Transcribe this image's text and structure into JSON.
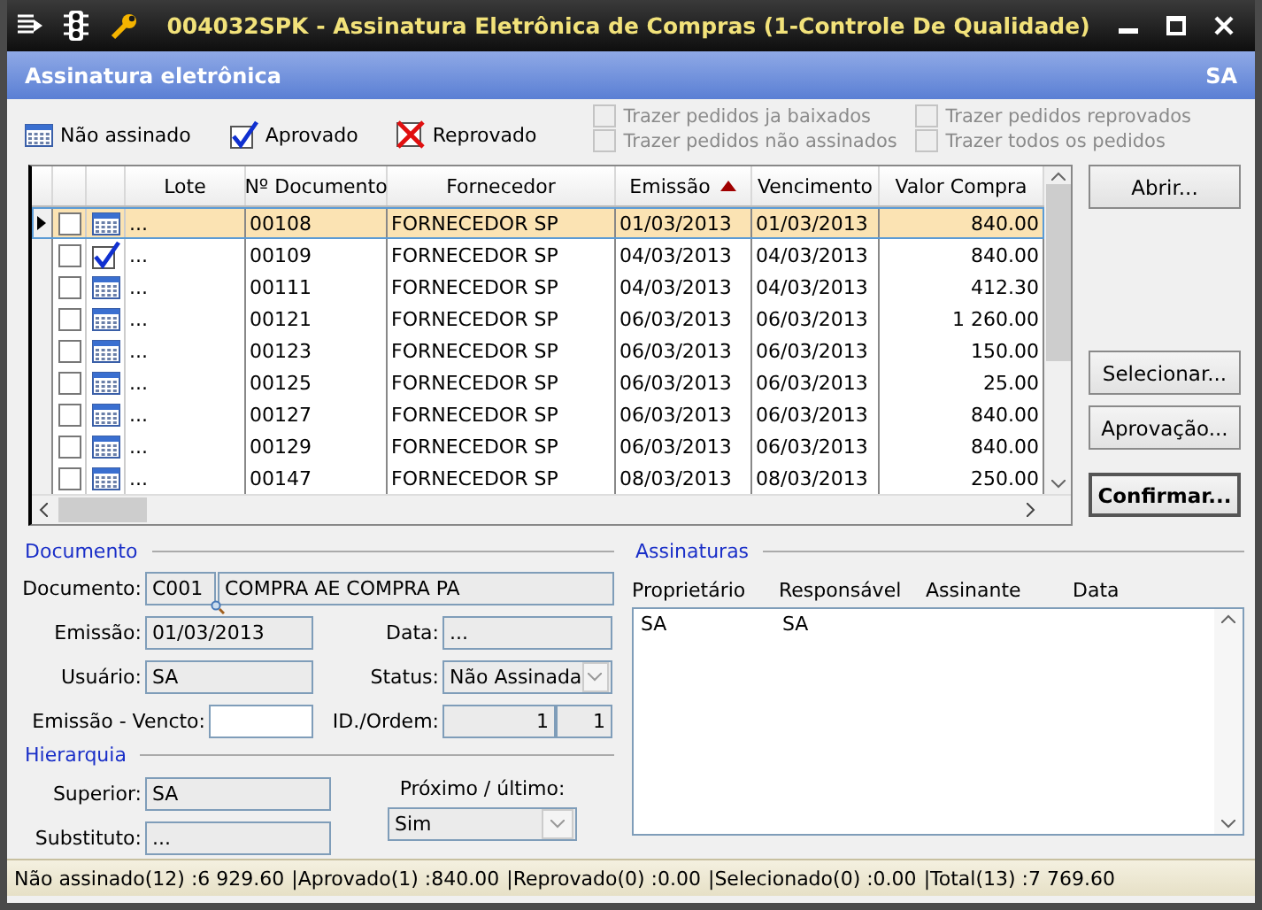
{
  "window": {
    "title": "004032SPK - Assinatura Eletrônica de Compras (1-Controle De Qualidade)"
  },
  "header": {
    "title": "Assinatura eletrônica",
    "user": "SA"
  },
  "legend": [
    {
      "kind": "pending",
      "label": "Não assinado"
    },
    {
      "kind": "approved",
      "label": "Aprovado"
    },
    {
      "kind": "rejected",
      "label": "Reprovado"
    }
  ],
  "filters": [
    {
      "label": "Trazer pedidos ja baixados",
      "checked": false,
      "disabled": true
    },
    {
      "label": "Trazer pedidos não assinados",
      "checked": false,
      "disabled": true
    },
    {
      "label": "Trazer pedidos reprovados",
      "checked": false,
      "disabled": true
    },
    {
      "label": "Trazer todos os pedidos",
      "checked": false,
      "disabled": true
    }
  ],
  "table": {
    "columns": [
      {
        "label": "Lote",
        "sorted": false
      },
      {
        "label": "Nº Documento",
        "sorted": false
      },
      {
        "label": "Fornecedor",
        "sorted": false
      },
      {
        "label": "Emissão",
        "sorted": true
      },
      {
        "label": "Vencimento",
        "sorted": false
      },
      {
        "label": "Valor Compra",
        "sorted": false
      }
    ],
    "rows": [
      {
        "selected": true,
        "checked": false,
        "kind": "pending",
        "cells": [
          "...",
          "00108",
          "FORNECEDOR SP",
          "01/03/2013",
          "01/03/2013",
          "840.00"
        ]
      },
      {
        "selected": false,
        "checked": false,
        "kind": "approved",
        "cells": [
          "...",
          "00109",
          "FORNECEDOR SP",
          "04/03/2013",
          "04/03/2013",
          "840.00"
        ]
      },
      {
        "selected": false,
        "checked": false,
        "kind": "pending",
        "cells": [
          "...",
          "00111",
          "FORNECEDOR SP",
          "04/03/2013",
          "04/03/2013",
          "412.30"
        ]
      },
      {
        "selected": false,
        "checked": false,
        "kind": "pending",
        "cells": [
          "...",
          "00121",
          "FORNECEDOR SP",
          "06/03/2013",
          "06/03/2013",
          "1 260.00"
        ]
      },
      {
        "selected": false,
        "checked": false,
        "kind": "pending",
        "cells": [
          "...",
          "00123",
          "FORNECEDOR SP",
          "06/03/2013",
          "06/03/2013",
          "150.00"
        ]
      },
      {
        "selected": false,
        "checked": false,
        "kind": "pending",
        "cells": [
          "...",
          "00125",
          "FORNECEDOR SP",
          "06/03/2013",
          "06/03/2013",
          "25.00"
        ]
      },
      {
        "selected": false,
        "checked": false,
        "kind": "pending",
        "cells": [
          "...",
          "00127",
          "FORNECEDOR SP",
          "06/03/2013",
          "06/03/2013",
          "840.00"
        ]
      },
      {
        "selected": false,
        "checked": false,
        "kind": "pending",
        "cells": [
          "...",
          "00129",
          "FORNECEDOR SP",
          "06/03/2013",
          "06/03/2013",
          "840.00"
        ]
      },
      {
        "selected": false,
        "checked": false,
        "kind": "pending",
        "cells": [
          "...",
          "00147",
          "FORNECEDOR SP",
          "08/03/2013",
          "08/03/2013",
          "250.00"
        ]
      }
    ]
  },
  "buttons": [
    {
      "label": "Abrir...",
      "kind": "normal"
    },
    {
      "label": "Selecionar...",
      "kind": "normal"
    },
    {
      "label": "Aprovação...",
      "kind": "normal"
    },
    {
      "label": "Confirmar...",
      "kind": "default"
    }
  ],
  "document": {
    "title": "Documento",
    "code_label": "Documento:",
    "code": "C001",
    "description": "COMPRA AE COMPRA PA",
    "emissao_label": "Emissão:",
    "emissao": "01/03/2013",
    "data_label": "Data:",
    "data": "...",
    "usuario_label": "Usuário:",
    "usuario": "SA",
    "status_label": "Status:",
    "status": "Não Assinada",
    "vencto_label": "Emissão - Vencto:",
    "id_label": "ID./Ordem:",
    "id": "1",
    "ordem": "1"
  },
  "hierarchy": {
    "title": "Hierarquia",
    "superior_label": "Superior:",
    "superior": "SA",
    "substituto_label": "Substituto:",
    "substituto": "...",
    "proximo_label": "Próximo / último:",
    "proximo": "Sim"
  },
  "signatures": {
    "title": "Assinaturas",
    "columns": [
      "Proprietário",
      "Responsável",
      "Assinante",
      "Data"
    ],
    "rows": [
      [
        "SA",
        "SA"
      ]
    ]
  },
  "status_bar": [
    "Não assinado(12) :6 929.60",
    "|Aprovado(1) :840.00",
    "|Reprovado(0) :0.00",
    "|Selecionado(0) :0.00",
    "|Total(13) :7 769.60"
  ]
}
